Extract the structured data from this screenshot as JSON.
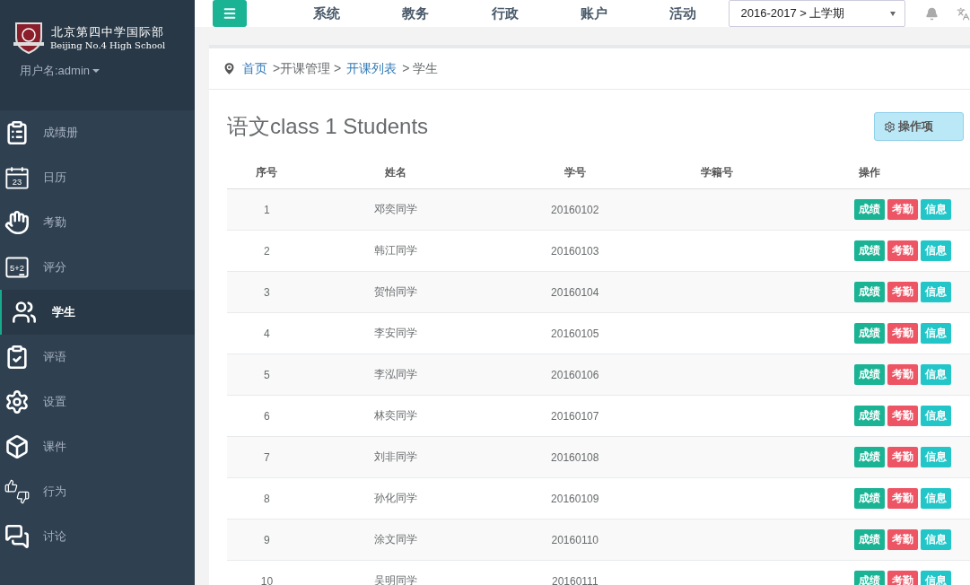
{
  "school": {
    "name_cn": "北京第四中学国际部",
    "name_en": "Beijing No.4 High School"
  },
  "user": {
    "label": "用户名:admin"
  },
  "sidebar": {
    "items": [
      {
        "kind": "clipboard",
        "label": "成绩册",
        "selected": false
      },
      {
        "kind": "calendar",
        "label": "日历",
        "selected": false,
        "icon_text": "23"
      },
      {
        "kind": "hand",
        "label": "考勤",
        "selected": false
      },
      {
        "kind": "board",
        "label": "评分",
        "selected": false,
        "icon_text": "5+2"
      },
      {
        "kind": "users",
        "label": "学生",
        "selected": true
      },
      {
        "kind": "check",
        "label": "评语",
        "selected": false
      },
      {
        "kind": "gear",
        "label": "设置",
        "selected": false
      },
      {
        "kind": "box",
        "label": "课件",
        "selected": false
      },
      {
        "kind": "thumbs",
        "label": "行为",
        "selected": false
      },
      {
        "kind": "chat",
        "label": "讨论",
        "selected": false
      }
    ]
  },
  "topbar": {
    "nav": [
      "系统",
      "教务",
      "行政",
      "账户",
      "活动"
    ],
    "term": "2016-2017 > 上学期"
  },
  "breadcrumb": [
    {
      "label": "首页",
      "link": true
    },
    {
      "label": ">开课管理 >",
      "link": false
    },
    {
      "label": "开课列表",
      "link": true
    },
    {
      "label": "> 学生",
      "link": false
    }
  ],
  "title": "语文class 1 Students",
  "actions_button": "操作项",
  "table": {
    "columns": [
      "序号",
      "姓名",
      "学号",
      "学籍号",
      "操作"
    ],
    "rows": [
      {
        "cells": [
          "1",
          "邓奕同学",
          "20160102"
        ],
        "buttons": [
          {
            "label": "成绩",
            "color": "#1ab394"
          },
          {
            "label": "考勤",
            "color": "#ed5565"
          },
          {
            "label": "信息",
            "color": "#23c6c8"
          }
        ]
      },
      {
        "cells": [
          "2",
          "韩江同学",
          "20160103"
        ],
        "buttons": [
          {
            "label": "成绩",
            "color": "#1ab394"
          },
          {
            "label": "考勤",
            "color": "#ed5565"
          },
          {
            "label": "信息",
            "color": "#23c6c8"
          }
        ]
      },
      {
        "cells": [
          "3",
          "贺怡同学",
          "20160104"
        ],
        "buttons": [
          {
            "label": "成绩",
            "color": "#1ab394"
          },
          {
            "label": "考勤",
            "color": "#ed5565"
          },
          {
            "label": "信息",
            "color": "#23c6c8"
          }
        ]
      },
      {
        "cells": [
          "4",
          "李安同学",
          "20160105"
        ],
        "buttons": [
          {
            "label": "成绩",
            "color": "#1ab394"
          },
          {
            "label": "考勤",
            "color": "#ed5565"
          },
          {
            "label": "信息",
            "color": "#23c6c8"
          }
        ]
      },
      {
        "cells": [
          "5",
          "李泓同学",
          "20160106"
        ],
        "buttons": [
          {
            "label": "成绩",
            "color": "#1ab394"
          },
          {
            "label": "考勤",
            "color": "#ed5565"
          },
          {
            "label": "信息",
            "color": "#23c6c8"
          }
        ]
      },
      {
        "cells": [
          "6",
          "林奕同学",
          "20160107"
        ],
        "buttons": [
          {
            "label": "成绩",
            "color": "#1ab394"
          },
          {
            "label": "考勤",
            "color": "#ed5565"
          },
          {
            "label": "信息",
            "color": "#23c6c8"
          }
        ]
      },
      {
        "cells": [
          "7",
          "刘非同学",
          "20160108"
        ],
        "buttons": [
          {
            "label": "成绩",
            "color": "#1ab394"
          },
          {
            "label": "考勤",
            "color": "#ed5565"
          },
          {
            "label": "信息",
            "color": "#23c6c8"
          }
        ]
      },
      {
        "cells": [
          "8",
          "孙化同学",
          "20160109"
        ],
        "buttons": [
          {
            "label": "成绩",
            "color": "#1ab394"
          },
          {
            "label": "考勤",
            "color": "#ed5565"
          },
          {
            "label": "信息",
            "color": "#23c6c8"
          }
        ]
      },
      {
        "cells": [
          "9",
          "涂文同学",
          "20160110"
        ],
        "buttons": [
          {
            "label": "成绩",
            "color": "#1ab394"
          },
          {
            "label": "考勤",
            "color": "#ed5565"
          },
          {
            "label": "信息",
            "color": "#23c6c8"
          }
        ]
      },
      {
        "cells": [
          "10",
          "吴明同学",
          "20160111"
        ],
        "buttons": [
          {
            "label": "成绩",
            "color": "#1ab394"
          },
          {
            "label": "考勤",
            "color": "#ed5565"
          },
          {
            "label": "信息",
            "color": "#23c6c8"
          }
        ]
      }
    ]
  }
}
